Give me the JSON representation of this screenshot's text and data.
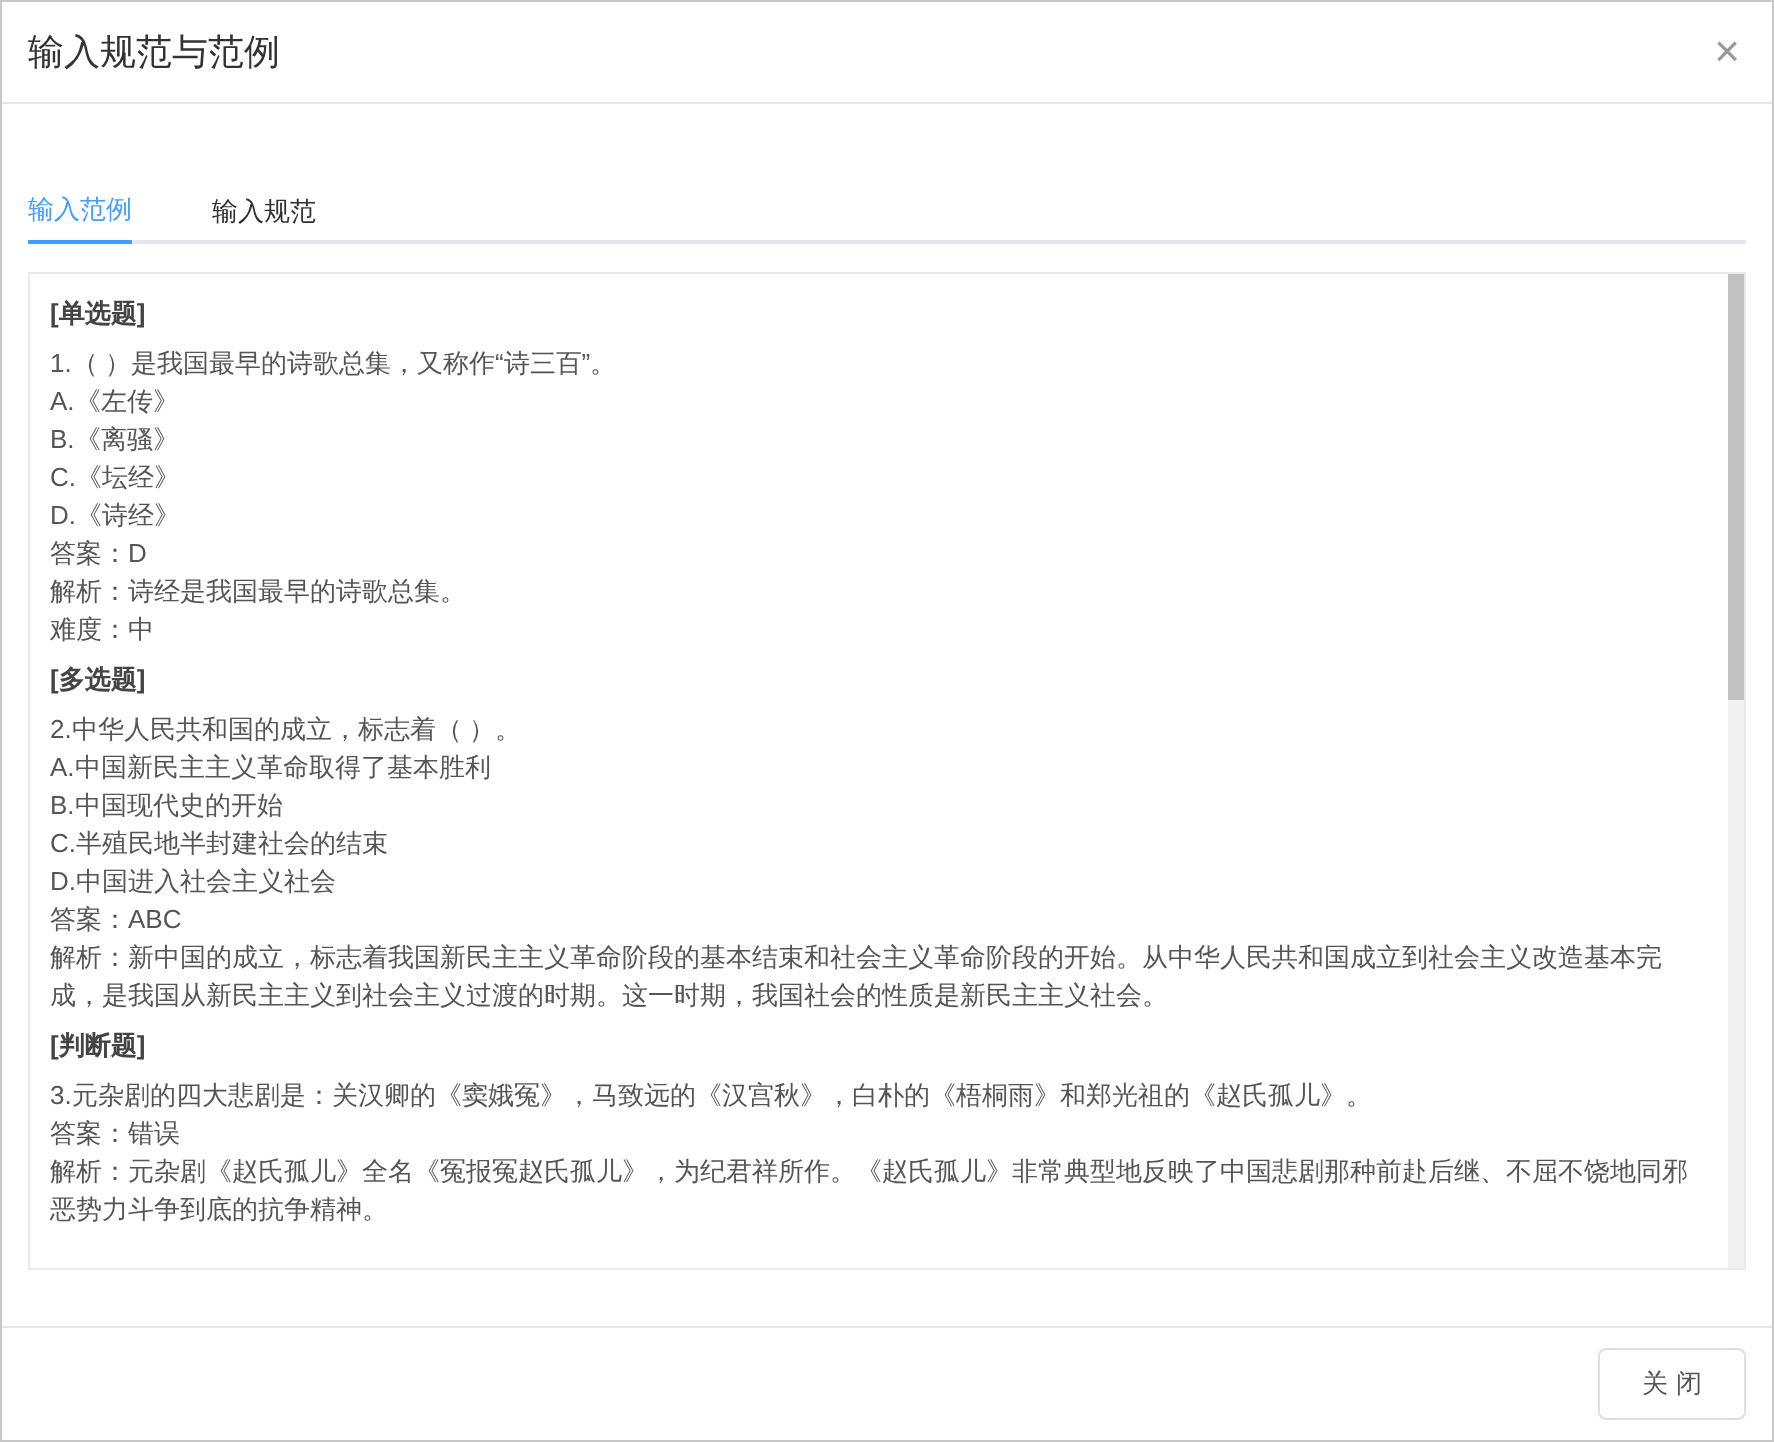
{
  "dialog": {
    "title": "输入规范与范例",
    "close": "×"
  },
  "tabs": [
    {
      "label": "输入范例",
      "selected": true
    },
    {
      "label": "输入规范",
      "selected": false
    }
  ],
  "sections": [
    {
      "heading": "[单选题]",
      "lines": [
        "1.（ ）是我国最早的诗歌总集，又称作“诗三百”。",
        "A.《左传》",
        "B.《离骚》",
        "C.《坛经》",
        "D.《诗经》",
        "答案：D",
        "解析：诗经是我国最早的诗歌总集。",
        "难度：中"
      ]
    },
    {
      "heading": "[多选题]",
      "lines": [
        "2.中华人民共和国的成立，标志着（ ）。",
        "A.中国新民主主义革命取得了基本胜利",
        "B.中国现代史的开始",
        "C.半殖民地半封建社会的结束",
        "D.中国进入社会主义社会",
        "答案：ABC",
        "解析：新中国的成立，标志着我国新民主主义革命阶段的基本结束和社会主义革命阶段的开始。从中华人民共和国成立到社会主义改造基本完成，是我国从新民主主义到社会主义过渡的时期。这一时期，我国社会的性质是新民主主义社会。"
      ]
    },
    {
      "heading": "[判断题]",
      "lines": [
        "3.元杂剧的四大悲剧是：关汉卿的《窦娥冤》，马致远的《汉宫秋》，白朴的《梧桐雨》和郑光祖的《赵氏孤儿》。",
        "答案：错误",
        "解析：元杂剧《赵氏孤儿》全名《冤报冤赵氏孤儿》，为纪君祥所作。《赵氏孤儿》非常典型地反映了中国悲剧那种前赴后继、不屈不饶地同邪恶势力斗争到底的抗争精神。"
      ]
    }
  ],
  "footer": {
    "button": "关 闭"
  }
}
